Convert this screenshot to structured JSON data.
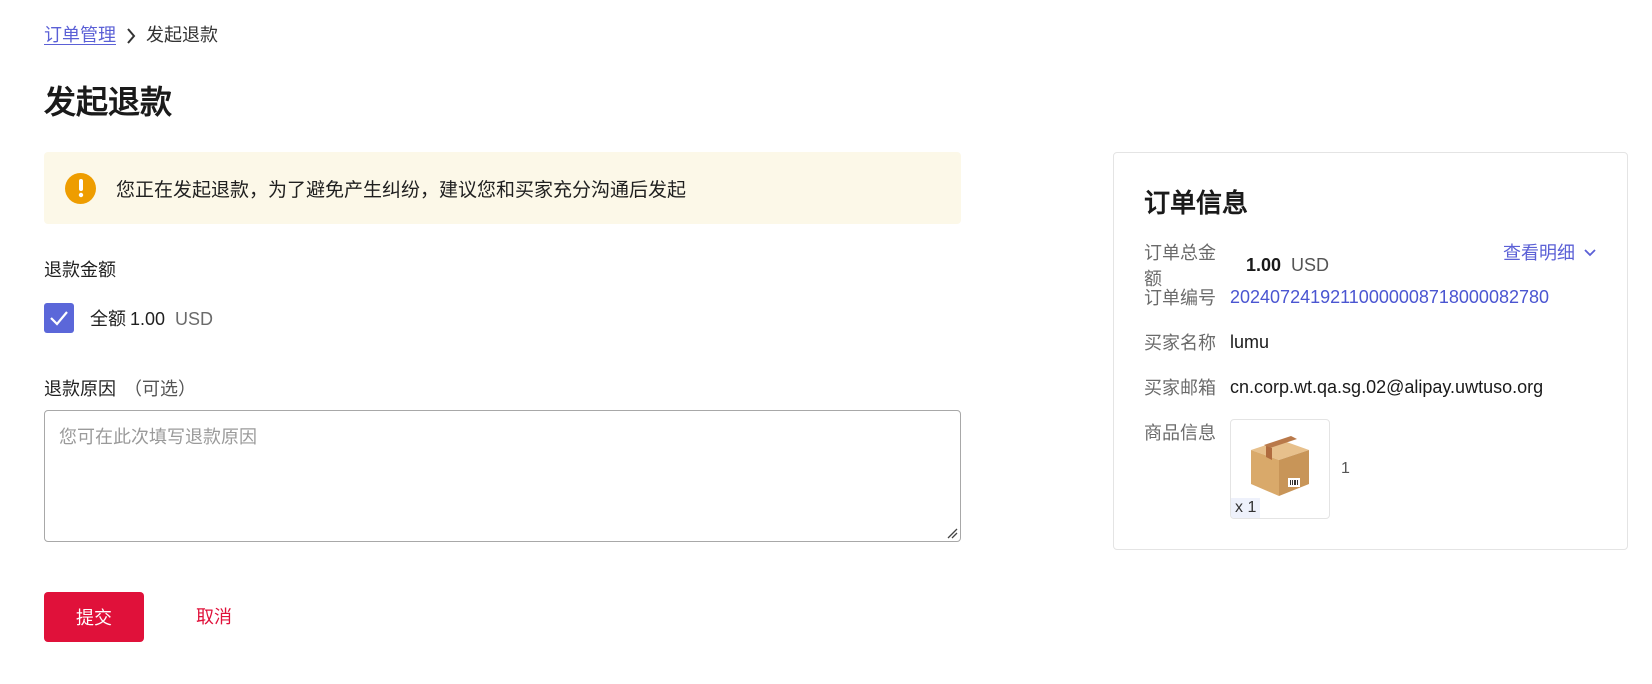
{
  "breadcrumb": {
    "parent": "订单管理",
    "current": "发起退款"
  },
  "page_title": "发起退款",
  "warning": {
    "text": "您正在发起退款，为了避免产生纠纷，建议您和买家充分沟通后发起"
  },
  "refund_amount": {
    "label": "退款金额",
    "checked": true,
    "option_label": "全额",
    "amount": "1.00",
    "currency": "USD"
  },
  "refund_reason": {
    "label": "退款原因",
    "optional": "（可选）",
    "placeholder": "您可在此次填写退款原因",
    "value": ""
  },
  "actions": {
    "submit": "提交",
    "cancel": "取消"
  },
  "order_info": {
    "title": "订单信息",
    "total_label": "订单总金额",
    "total_amount": "1.00",
    "total_currency": "USD",
    "detail_link": "查看明细",
    "order_no_label": "订单编号",
    "order_no": "20240724192110000008718000082780",
    "buyer_name_label": "买家名称",
    "buyer_name": "lumu",
    "buyer_email_label": "买家邮箱",
    "buyer_email": "cn.corp.wt.qa.sg.02@alipay.uwtuso.org",
    "goods_label": "商品信息",
    "goods_qty": "x 1",
    "goods_name": "1"
  },
  "colors": {
    "accent": "#5b60d6",
    "primary_button": "#e0113a",
    "warning_bg": "#fcf8e8",
    "warning_icon": "#ee9d00",
    "checkbox": "#5b67d9"
  },
  "icons": [
    "chevron-right-icon",
    "warning-icon",
    "checkmark-icon",
    "chevron-down-icon",
    "package-box-icon",
    "resize-handle-icon"
  ]
}
